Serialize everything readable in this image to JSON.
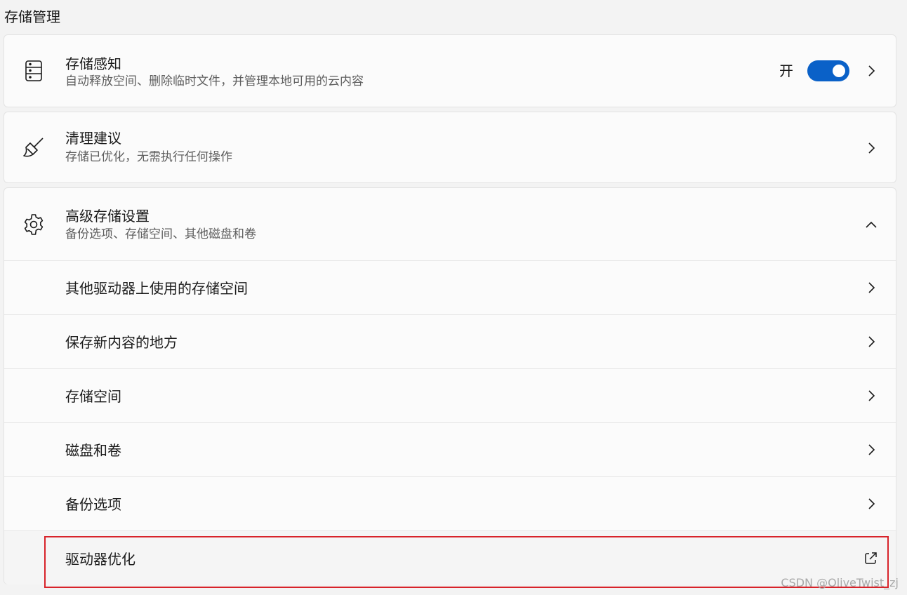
{
  "page": {
    "section_title": "存储管理"
  },
  "storage_sense": {
    "icon": "storage-drive-icon",
    "title": "存储感知",
    "subtitle": "自动释放空间、删除临时文件，并管理本地可用的云内容",
    "toggle_label": "开",
    "toggle_on": true
  },
  "cleanup": {
    "icon": "broom-icon",
    "title": "清理建议",
    "subtitle": "存储已优化，无需执行任何操作"
  },
  "advanced": {
    "icon": "gear-icon",
    "title": "高级存储设置",
    "subtitle": "备份选项、存储空间、其他磁盘和卷",
    "expanded": true,
    "items": [
      {
        "label": "其他驱动器上使用的存储空间",
        "action": "chevron-right-icon"
      },
      {
        "label": "保存新内容的地方",
        "action": "chevron-right-icon"
      },
      {
        "label": "存储空间",
        "action": "chevron-right-icon"
      },
      {
        "label": "磁盘和卷",
        "action": "chevron-right-icon"
      },
      {
        "label": "备份选项",
        "action": "chevron-right-icon"
      },
      {
        "label": "驱动器优化",
        "action": "external-link-icon"
      }
    ]
  },
  "colors": {
    "accent": "#0a61c8",
    "highlight": "#d8232a",
    "background": "#f3f3f3",
    "card": "#fbfbfb"
  },
  "watermark": "CSDN @OliveTwist_zj"
}
